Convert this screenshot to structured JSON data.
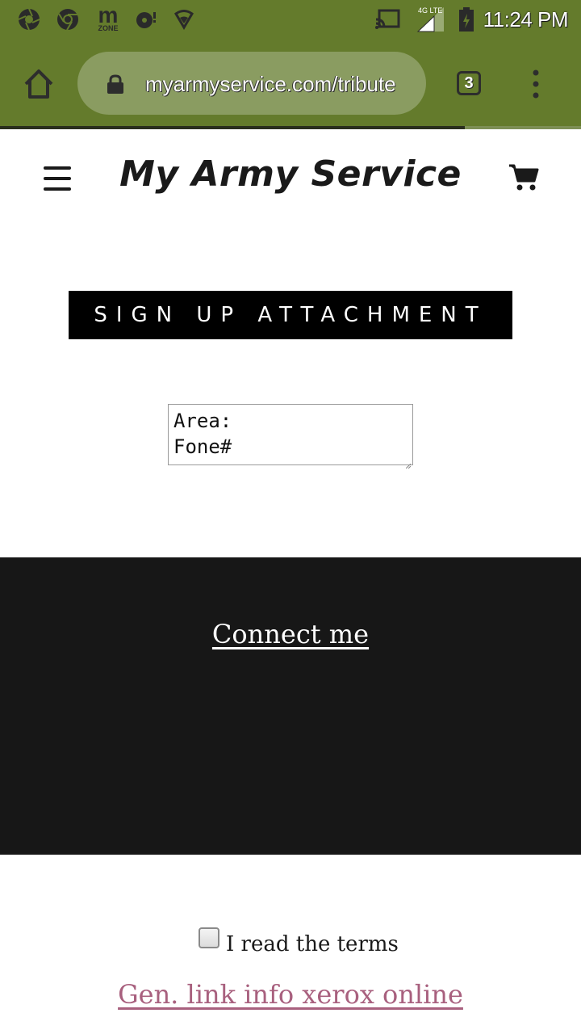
{
  "status_bar": {
    "time": "11:24 PM",
    "network": "4G LTE",
    "left_icons": [
      "aperture-icon",
      "chrome-icon",
      "mzone-icon",
      "vpn-icon",
      "wifi-shield-icon"
    ],
    "right_icons": [
      "cast-icon",
      "signal-icon",
      "battery-icon"
    ],
    "mzone_letter": "m",
    "mzone_label": "ZONE"
  },
  "browser": {
    "url": "myarmyservice.com/tribute",
    "tab_count": "3",
    "load_progress": 0.8,
    "theme_color": "#647b2c"
  },
  "site": {
    "title": "My Army Service"
  },
  "main": {
    "banner_label": "SIGN UP ATTACHMENT",
    "textarea_value": "Area:\nFone#"
  },
  "dark_section": {
    "link_label": "Connect me"
  },
  "footer": {
    "checkbox_label": "I read the terms",
    "checkbox_checked": false,
    "link_label": "Gen. link info xerox online",
    "link_color": "#a8607e"
  }
}
